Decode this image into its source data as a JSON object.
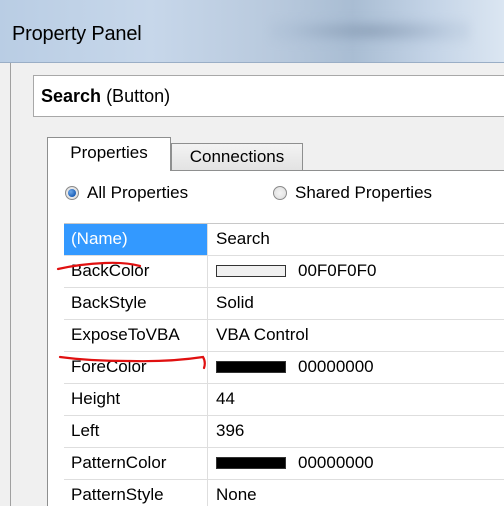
{
  "window": {
    "title": "Property Panel"
  },
  "selection": {
    "object_name": "Search",
    "object_type": "(Button)"
  },
  "tabs": [
    {
      "label": "Properties",
      "active": true
    },
    {
      "label": "Connections",
      "active": false
    }
  ],
  "filter": {
    "all_label": "All Properties",
    "shared_label": "Shared Properties",
    "selected": "all"
  },
  "properties": [
    {
      "name": "(Name)",
      "value": "Search",
      "selected": true
    },
    {
      "name": "BackColor",
      "value": "00F0F0F0",
      "swatch": "#F0F0F0"
    },
    {
      "name": "BackStyle",
      "value": "Solid"
    },
    {
      "name": "ExposeToVBA",
      "value": "VBA Control"
    },
    {
      "name": "ForeColor",
      "value": "00000000",
      "swatch": "#000000"
    },
    {
      "name": "Height",
      "value": "44"
    },
    {
      "name": "Left",
      "value": "396"
    },
    {
      "name": "PatternColor",
      "value": "00000000",
      "swatch": "#000000"
    },
    {
      "name": "PatternStyle",
      "value": "None"
    }
  ],
  "colors": {
    "selection_highlight": "#3399FF",
    "annotation": "#E01010"
  }
}
